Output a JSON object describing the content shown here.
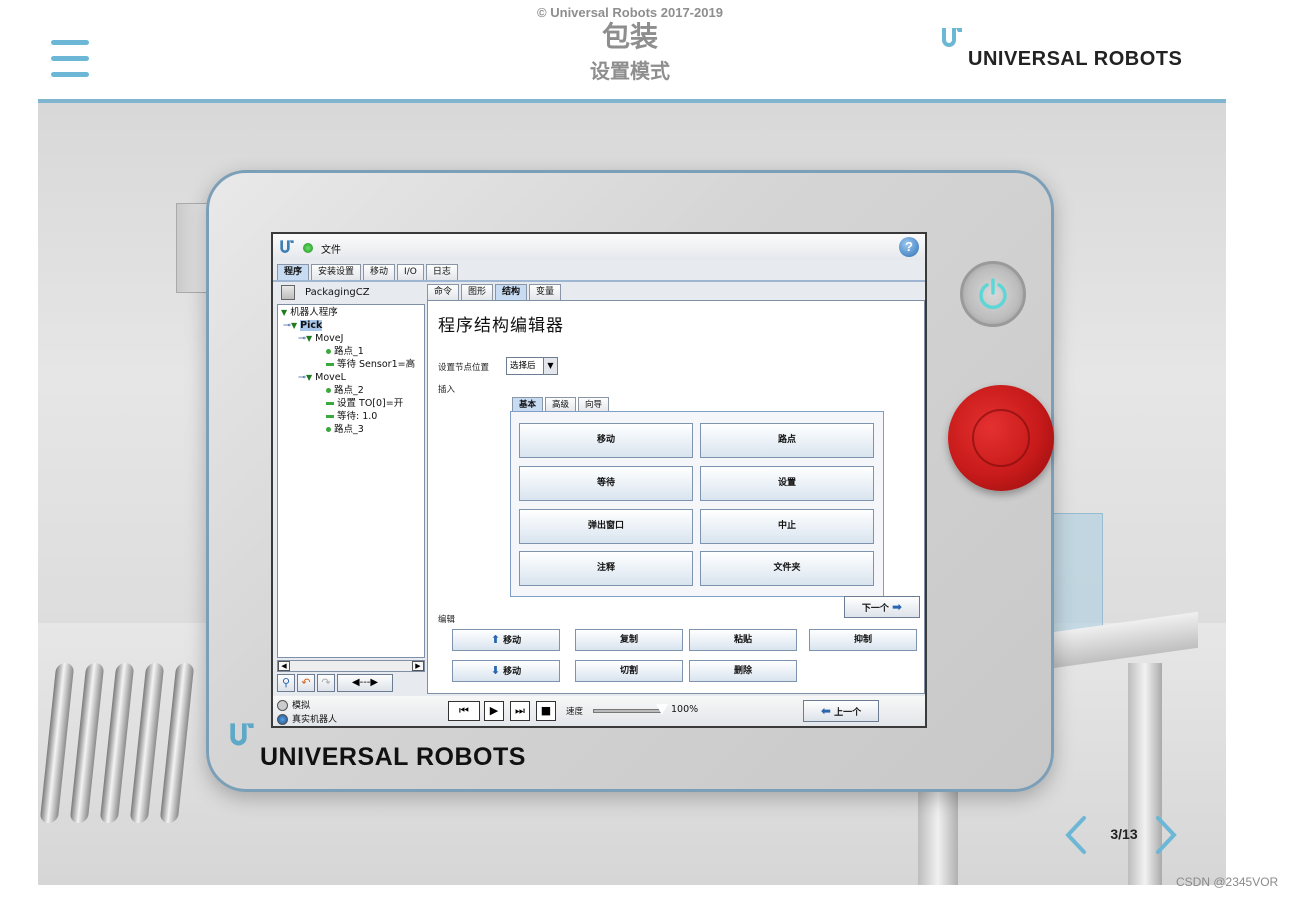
{
  "header": {
    "copyright": "© Universal Robots 2017-2019",
    "title": "包装",
    "subtitle": "设置模式",
    "brand": "UNIVERSAL ROBOTS"
  },
  "pendant": {
    "brand": "UNIVERSAL ROBOTS",
    "screen": {
      "topbar": {
        "file_label": "文件",
        "help": "?"
      },
      "main_tabs": [
        "程序",
        "安装设置",
        "移动",
        "I/O",
        "日志"
      ],
      "main_tab_active": "程序",
      "program_name": "PackagingCZ",
      "tree": {
        "root": "机器人程序",
        "pick": "Pick",
        "movej": "MoveJ",
        "waypoint1": "路点_1",
        "wait_sensor": "等待 Sensor1=高",
        "movel": "MoveL",
        "waypoint2": "路点_2",
        "set_to": "设置 TO[0]=开",
        "wait_time": "等待: 1.0",
        "waypoint3": "路点_3"
      },
      "sub_tabs": [
        "命令",
        "图形",
        "结构",
        "变量"
      ],
      "sub_tab_active": "结构",
      "panel_title": "程序结构编辑器",
      "node_position_label": "设置节点位置",
      "node_position_value": "选择后",
      "insert_label": "插入",
      "insert_tabs": [
        "基本",
        "高级",
        "向导"
      ],
      "insert_buttons": [
        "移动",
        "路点",
        "等待",
        "设置",
        "弹出窗口",
        "中止",
        "注释",
        "文件夹"
      ],
      "edit_label": "编辑",
      "edit_buttons": {
        "move_up": "移动",
        "copy": "复制",
        "paste": "粘贴",
        "suppress": "抑制",
        "move_down": "移动",
        "cut": "切割",
        "delete": "删除"
      },
      "bottombar": {
        "simulation": "模拟",
        "real_robot": "真实机器人",
        "speed_label": "速度",
        "speed_value": "100%",
        "speed_fraction": 1.0,
        "prev": "上一个",
        "next": "下一个"
      }
    }
  },
  "slide_counter": "3/13",
  "watermark": "CSDN @2345VOR",
  "colors": {
    "accent": "#6db7d6",
    "header_line": "#7fb5cf",
    "estop": "#c71a1a"
  }
}
